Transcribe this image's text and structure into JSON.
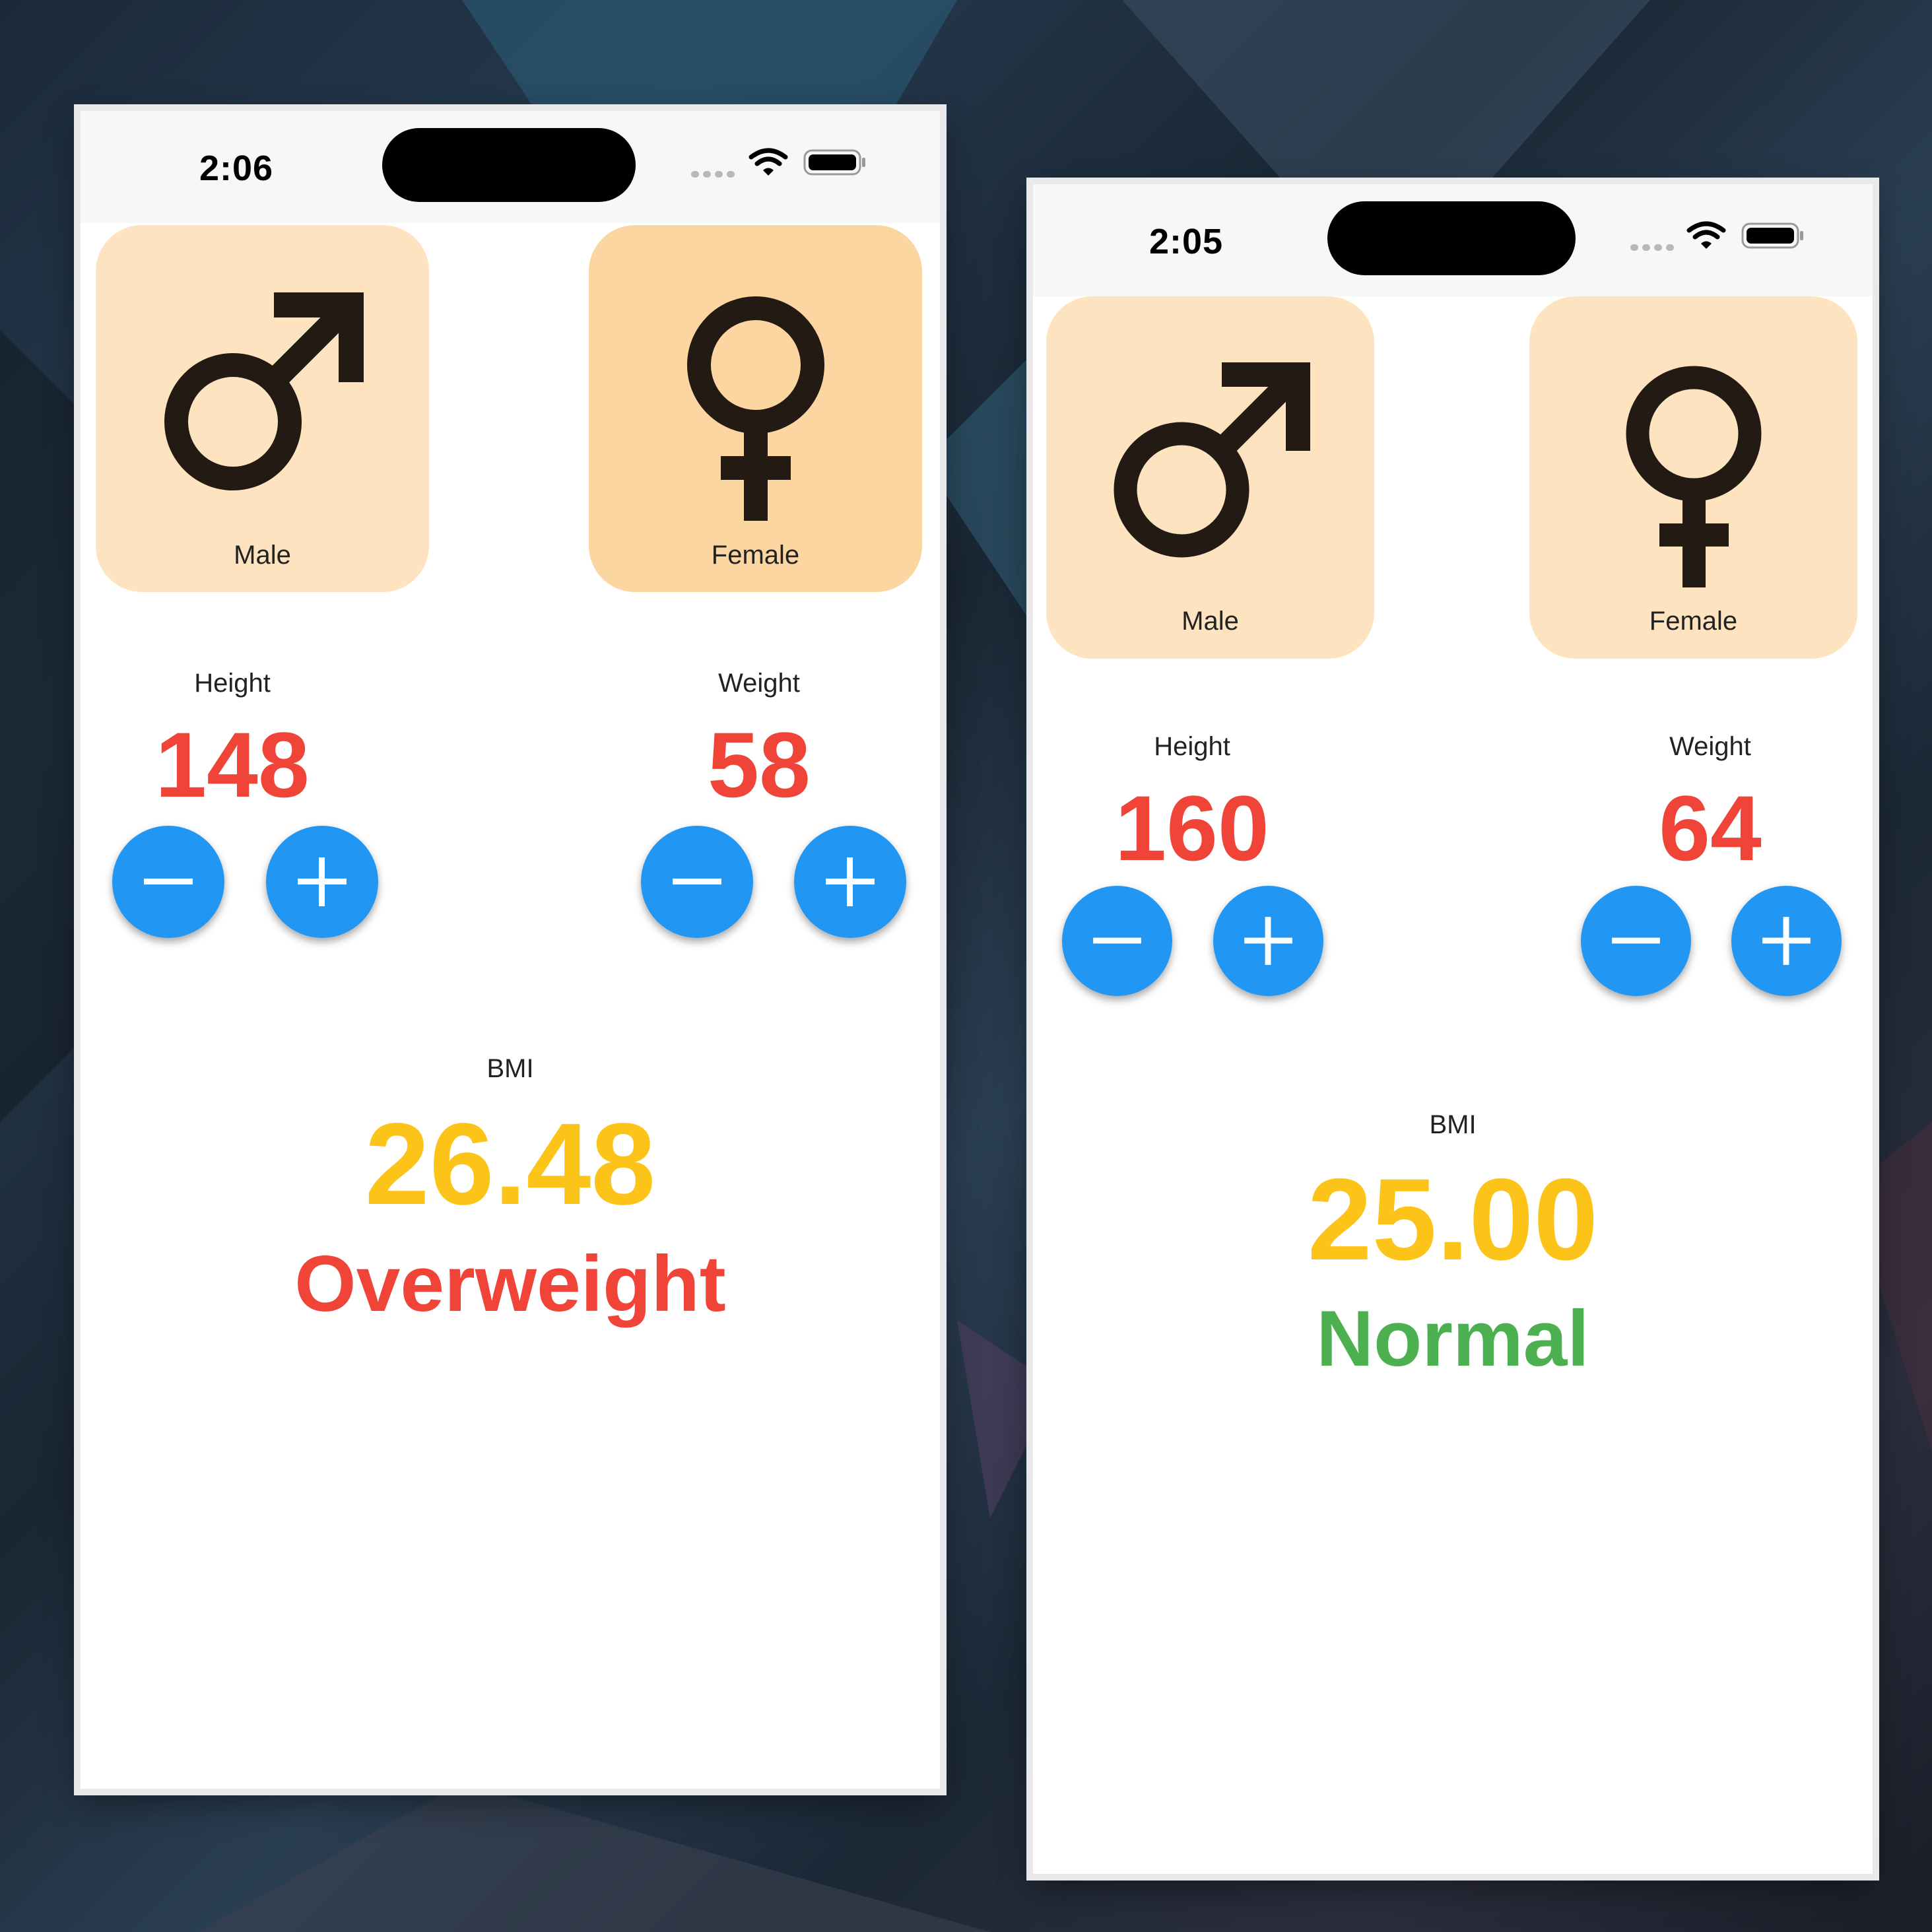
{
  "screens": [
    {
      "status_time": "2:06",
      "gender_options": [
        {
          "label": "Male",
          "icon": "male-symbol-icon",
          "color": "#fde3bf"
        },
        {
          "label": "Female",
          "icon": "female-symbol-icon",
          "color": "#fbd6a1"
        }
      ],
      "height": {
        "label": "Height",
        "value": "148"
      },
      "weight": {
        "label": "Weight",
        "value": "58"
      },
      "bmi": {
        "label": "BMI",
        "value": "26.48",
        "category": "Overweight",
        "category_color": "#f04438"
      }
    },
    {
      "status_time": "2:05",
      "gender_options": [
        {
          "label": "Male",
          "icon": "male-symbol-icon",
          "color": "#fde3bf"
        },
        {
          "label": "Female",
          "icon": "female-symbol-icon",
          "color": "#fde3bf"
        }
      ],
      "height": {
        "label": "Height",
        "value": "160"
      },
      "weight": {
        "label": "Weight",
        "value": "64"
      },
      "bmi": {
        "label": "BMI",
        "value": "25.00",
        "category": "Normal",
        "category_color": "#4caf50"
      }
    }
  ],
  "colors": {
    "accent_blue": "#2196f3",
    "value_red": "#f04438",
    "bmi_yellow": "#fcc419"
  }
}
